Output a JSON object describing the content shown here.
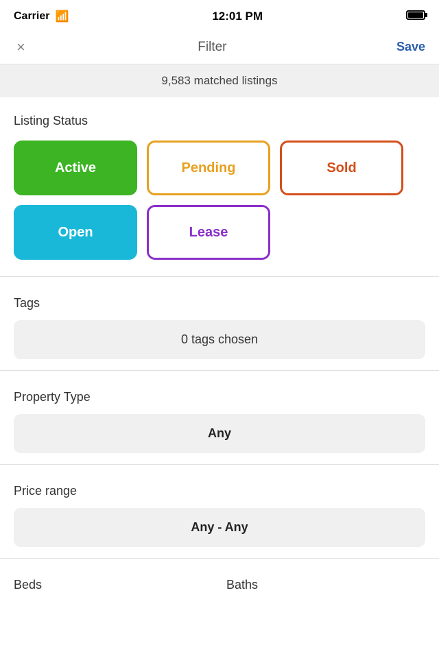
{
  "statusBar": {
    "carrier": "Carrier",
    "time": "12:01 PM"
  },
  "navBar": {
    "closeLabel": "×",
    "title": "Filter",
    "saveLabel": "Save"
  },
  "matchedListings": {
    "text": "9,583 matched listings"
  },
  "listingStatus": {
    "sectionTitle": "Listing Status",
    "buttons": [
      {
        "label": "Active",
        "type": "active",
        "selected": true
      },
      {
        "label": "Pending",
        "type": "pending",
        "selected": false
      },
      {
        "label": "Sold",
        "type": "sold",
        "selected": false
      },
      {
        "label": "Open",
        "type": "open",
        "selected": true
      },
      {
        "label": "Lease",
        "type": "lease",
        "selected": false
      }
    ]
  },
  "tags": {
    "sectionTitle": "Tags",
    "buttonLabel": "0 tags chosen"
  },
  "propertyType": {
    "sectionTitle": "Property Type",
    "buttonLabel": "Any"
  },
  "priceRange": {
    "sectionTitle": "Price range",
    "buttonLabel": "Any - Any"
  },
  "bedsLabel": "Beds",
  "bathsLabel": "Baths"
}
